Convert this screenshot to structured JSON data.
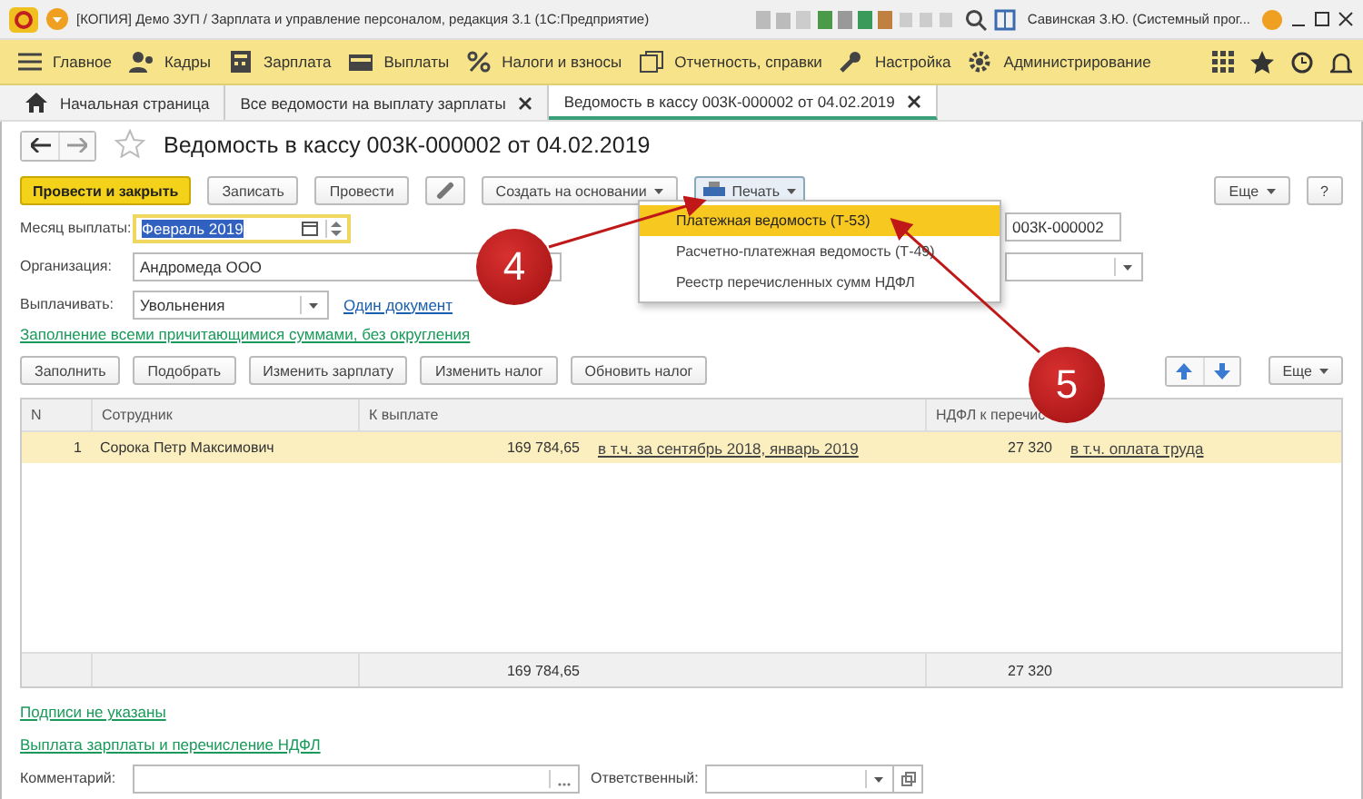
{
  "window": {
    "title": "[КОПИЯ] Демо ЗУП / Зарплата и управление персоналом, редакция 3.1  (1С:Предприятие)",
    "user": "Савинская З.Ю. (Системный прог..."
  },
  "sections": [
    {
      "label": "Главное"
    },
    {
      "label": "Кадры"
    },
    {
      "label": "Зарплата"
    },
    {
      "label": "Выплаты"
    },
    {
      "label": "Налоги и взносы"
    },
    {
      "label": "Отчетность, справки"
    },
    {
      "label": "Настройка"
    },
    {
      "label": "Администрирование"
    }
  ],
  "tabs": [
    {
      "label": "Начальная страница",
      "kind": "home",
      "selected": false
    },
    {
      "label": "Все ведомости на выплату зарплаты",
      "kind": "closable",
      "selected": false
    },
    {
      "label": "Ведомость в кассу 003К-000002 от 04.02.2019",
      "kind": "closable",
      "selected": true
    }
  ],
  "document": {
    "title": "Ведомость в кассу 003К-000002 от 04.02.2019"
  },
  "toolbar": {
    "post_close": "Провести и закрыть",
    "save": "Записать",
    "post": "Провести",
    "create_based": "Создать на основании",
    "print": "Печать",
    "more": "Еще",
    "help": "?"
  },
  "print_menu": [
    {
      "label": "Платежная ведомость (Т-53)",
      "selected": true
    },
    {
      "label": "Расчетно-платежная ведомость (Т-49)",
      "selected": false
    },
    {
      "label": "Реестр перечисленных сумм НДФЛ",
      "selected": false
    }
  ],
  "fields": {
    "month_label": "Месяц выплаты:",
    "month_value": "Февраль 2019",
    "org_label": "Организация:",
    "org_value": "Андромеда ООО",
    "pay_label": "Выплачивать:",
    "pay_value": "Увольнения",
    "one_doc_link": "Один документ",
    "number_value": "003К-000002"
  },
  "fill_link": "Заполнение всеми причитающимися суммами, без округления",
  "table_toolbar": {
    "buttons": [
      "Заполнить",
      "Подобрать",
      "Изменить зарплату",
      "Изменить налог",
      "Обновить налог"
    ],
    "more": "Еще"
  },
  "table": {
    "columns": [
      "N",
      "Сотрудник",
      "К выплате",
      "НДФЛ к перечис"
    ],
    "rows": [
      {
        "n": "1",
        "employee": "Сорока Петр Максимович",
        "amount": "169 784,65",
        "amount_link": "в т.ч. за сентябрь 2018, январь 2019",
        "tax": "27 320",
        "tax_link": "в т.ч. оплата труда",
        "selected": true
      }
    ],
    "totals": {
      "amount": "169 784,65",
      "tax": "27 320"
    }
  },
  "signatures_link": "Подписи не указаны",
  "payment_link": "Выплата зарплаты и перечисление НДФЛ",
  "footer": {
    "comment_label": "Комментарий:",
    "responsible_label": "Ответственный:"
  },
  "annotations": [
    {
      "number": "4"
    },
    {
      "number": "5"
    }
  ]
}
